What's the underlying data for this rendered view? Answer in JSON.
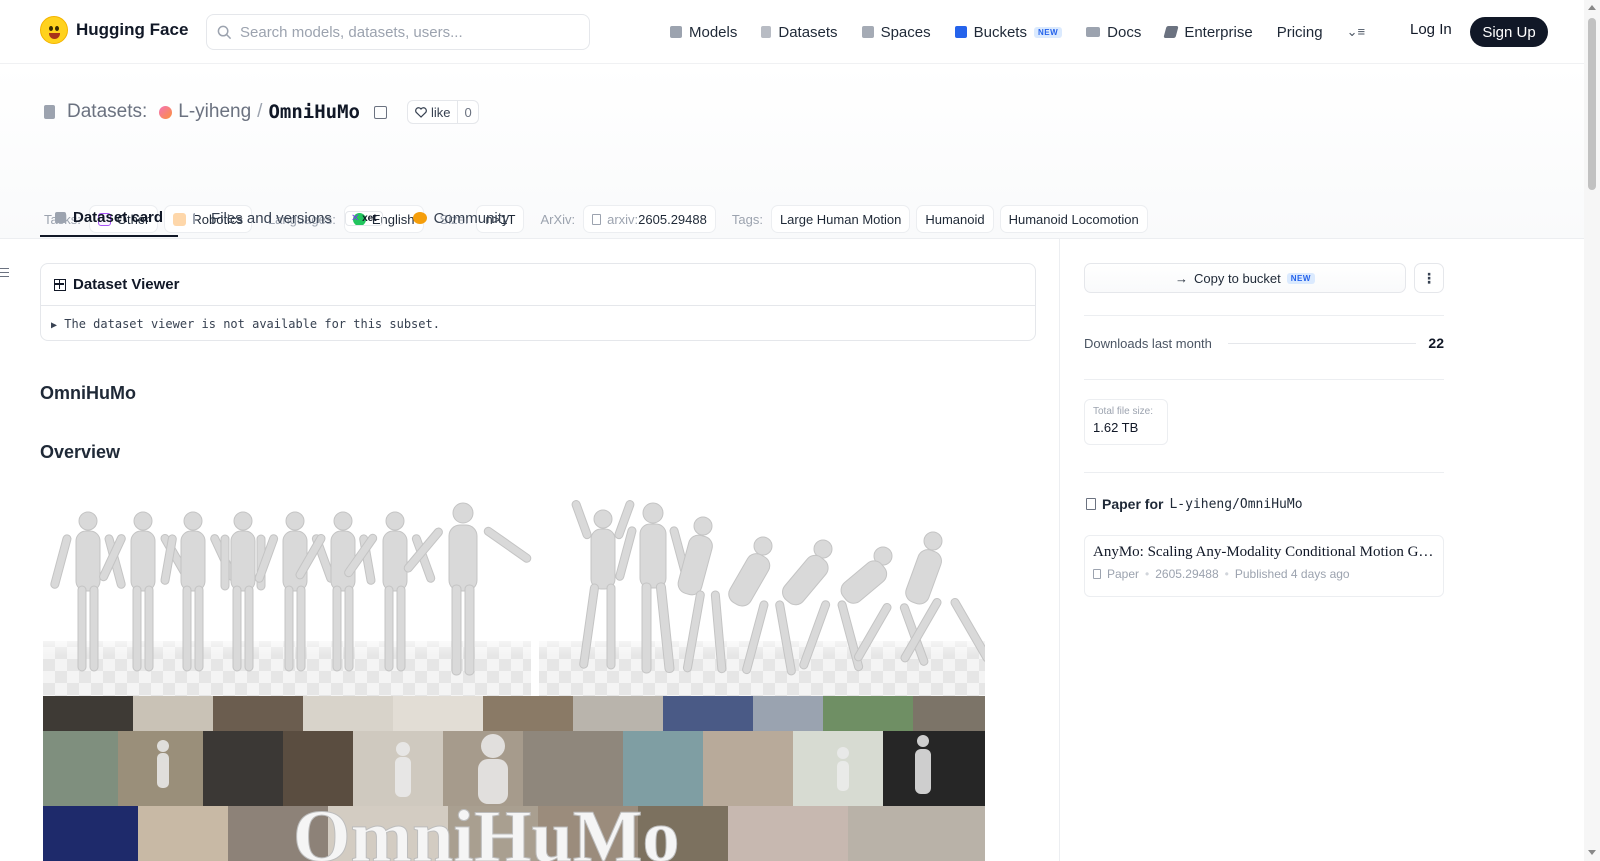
{
  "header": {
    "brand": "Hugging Face",
    "search_placeholder": "Search models, datasets, users...",
    "nav": [
      {
        "label": "Models",
        "icon": "cube-icon"
      },
      {
        "label": "Datasets",
        "icon": "database-icon"
      },
      {
        "label": "Spaces",
        "icon": "grid-icon"
      },
      {
        "label": "Buckets",
        "icon": "bucket-icon",
        "badge": "NEW"
      },
      {
        "label": "Docs",
        "icon": "book-icon"
      },
      {
        "label": "Enterprise",
        "icon": "enterprise-icon"
      },
      {
        "label": "Pricing"
      }
    ],
    "login": "Log In",
    "signup": "Sign Up"
  },
  "repo": {
    "type_label": "Datasets:",
    "owner": "L-yiheng",
    "separator": "/",
    "name": "OmniHuMo",
    "like_label": "like",
    "like_count": "0"
  },
  "tags": {
    "tasks_label": "Tasks:",
    "tasks": [
      "Other",
      "Robotics"
    ],
    "languages_label": "Languages:",
    "languages": [
      "English"
    ],
    "size_label": "Size:",
    "size": "n>1T",
    "arxiv_label": "ArXiv:",
    "arxiv_prefix": "arxiv:",
    "arxiv_id": "2605.29488",
    "tags_label": "Tags:",
    "tags": [
      "Large Human Motion",
      "Humanoid",
      "Humanoid Locomotion"
    ]
  },
  "tabs": {
    "dataset_card": "Dataset card",
    "files": "Files and versions",
    "xet": "xet",
    "community": "Community"
  },
  "viewer": {
    "title": "Dataset Viewer",
    "message": "The dataset viewer is not available for this subset."
  },
  "content": {
    "heading": "OmniHuMo",
    "overview": "Overview",
    "hero_text": "OmniHuMo"
  },
  "sidebar": {
    "copy_bucket": "Copy to bucket",
    "copy_bucket_badge": "NEW",
    "downloads_label": "Downloads last month",
    "downloads_value": "22",
    "file_size_label": "Total file size:",
    "file_size_value": "1.62 TB",
    "paper_for": "Paper for",
    "paper_repo": "L-yiheng/OmniHuMo",
    "paper_title": "AnyMo: Scaling Any-Modality Conditional Motion Generation",
    "paper_type": "Paper",
    "paper_id": "2605.29488",
    "paper_published": "Published 4 days ago"
  },
  "colors": {
    "primary_dark": "#111827",
    "accent_blue": "#2563eb",
    "border": "#e5e7eb",
    "muted": "#6b7280"
  }
}
